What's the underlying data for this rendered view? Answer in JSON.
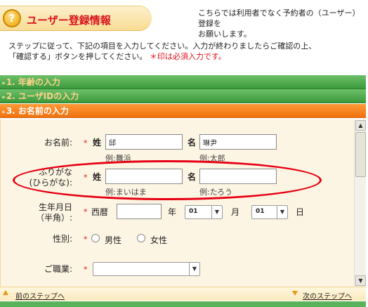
{
  "header": {
    "logo_glyph": "?",
    "title": "ユーザー登録情報",
    "note_line1": "こちらでは利用者でなく予約者の（ユーザー）登録を",
    "note_line2": "お願いします。"
  },
  "intro": {
    "line1": "ステップに従って、下記の項目を入力してください。入力が終わりましたらご確認の上、",
    "line2_prefix": "「確認する」ボタンを押してください。",
    "line2_required": "＊印は必須入力です。"
  },
  "sections": [
    {
      "label": "1. 年齢の入力",
      "state": "collapsed"
    },
    {
      "label": "2. ユーザIDの入力",
      "state": "collapsed"
    },
    {
      "label": "3. お名前の入力",
      "state": "active"
    }
  ],
  "section_arrow": "»",
  "form": {
    "required_mark": "*",
    "name": {
      "label": "お名前:",
      "sei_label": "姓",
      "mei_label": "名",
      "sei_value": "邱",
      "mei_value": "琳尹",
      "sei_hint": "例:舞浜",
      "mei_hint": "例:太郎"
    },
    "furigana": {
      "label_line1": "ふりがな",
      "label_line2": "(ひらがな):",
      "sei_label": "姓",
      "mei_label": "名",
      "sei_value": "",
      "mei_value": "",
      "sei_hint": "例:まいはま",
      "mei_hint": "例:たろう"
    },
    "birthday": {
      "label_line1": "生年月日",
      "label_line2": "（半角）:",
      "era": "西暦",
      "year_value": "",
      "year_unit": "年",
      "month_value": "01",
      "month_unit": "月",
      "day_value": "01",
      "day_unit": "日"
    },
    "gender": {
      "label": "性別:",
      "option_male": "男性",
      "option_female": "女性"
    },
    "occupation": {
      "label": "ご職業:",
      "value": ""
    }
  },
  "footer": {
    "prev": "前のステップへ",
    "next": "次のステップへ"
  },
  "colors": {
    "accent_red": "#e0131e",
    "section_green": "#3c9a3b",
    "section_orange": "#f0710f",
    "annotation": "#e60012"
  }
}
